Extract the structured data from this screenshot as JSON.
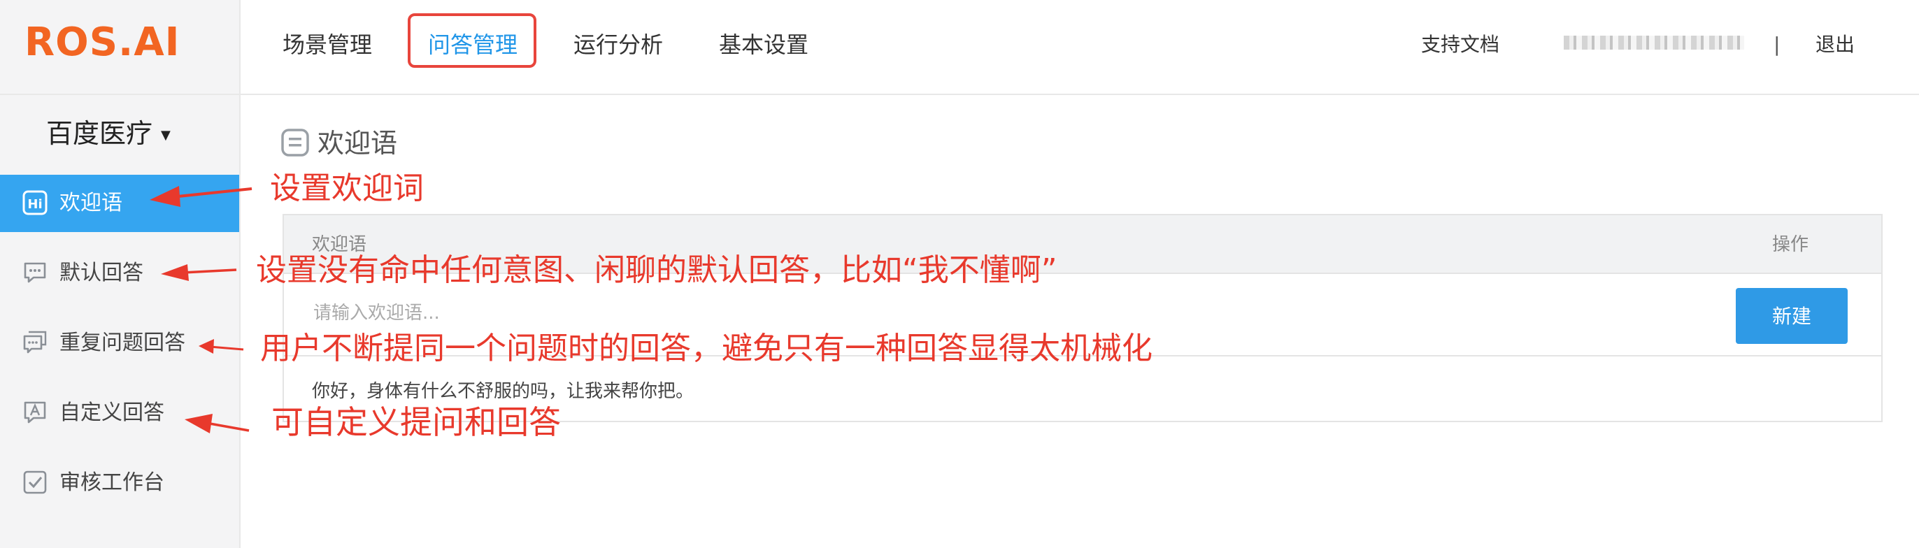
{
  "logo": "ROS.AI",
  "nav": {
    "items": [
      "场景管理",
      "问答管理",
      "运行分析",
      "基本设置"
    ],
    "active_index": 1
  },
  "topright": {
    "docs": "支持文档",
    "separator": "|",
    "logout": "退出"
  },
  "sidebar": {
    "project": "百度医疗",
    "items": [
      {
        "label": "欢迎语",
        "icon": "hi-icon",
        "active": true
      },
      {
        "label": "默认回答",
        "icon": "chat-bubble-icon",
        "active": false
      },
      {
        "label": "重复问题回答",
        "icon": "repeat-chat-icon",
        "active": false
      },
      {
        "label": "自定义回答",
        "icon": "custom-answer-icon",
        "active": false
      },
      {
        "label": "审核工作台",
        "icon": "check-square-icon",
        "active": false
      }
    ]
  },
  "main": {
    "title": "欢迎语",
    "table": {
      "col_title": "欢迎语",
      "col_action": "操作",
      "input_placeholder": "请输入欢迎语...",
      "new_button": "新建",
      "rows": [
        "你好，身体有什么不舒服的吗，让我来帮你把。"
      ]
    }
  },
  "annotations": [
    "设置欢迎词",
    "设置没有命中任何意图、闲聊的默认回答，比如“我不懂啊”",
    "用户不断提同一个问题时的回答，避免只有一种回答显得太机械化",
    "可自定义提问和回答"
  ],
  "colors": {
    "brand": "#f26522",
    "accent": "#2196e8",
    "sidebar_active": "#35a5f0",
    "annotation": "#e8392c"
  }
}
